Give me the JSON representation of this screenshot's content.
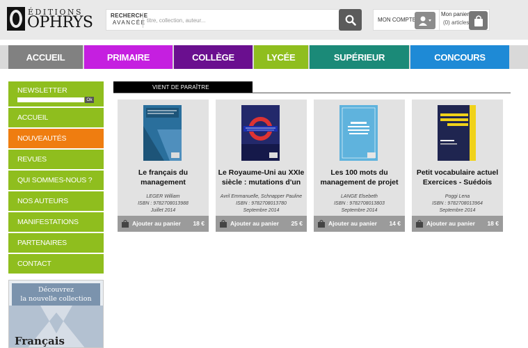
{
  "header": {
    "logo": {
      "top": "ÉDITIONS",
      "big": "OPHRYS"
    },
    "search": {
      "label_line1": "RECHERCHE",
      "label_line2": "AVANCÉE",
      "placeholder": "titre, collection, auteur..."
    },
    "account_label": "MON COMPTE",
    "cart": {
      "title": "Mon panier",
      "count": "(0) articles"
    }
  },
  "nav": {
    "tabs": [
      {
        "label": "ACCUEIL",
        "color": "#818181"
      },
      {
        "label": "PRIMAIRE",
        "color": "#c51fe0"
      },
      {
        "label": "COLLÈGE",
        "color": "#6a0f8f"
      },
      {
        "label": "LYCÉE",
        "color": "#8fbe1e"
      },
      {
        "label": "SUPÉRIEUR",
        "color": "#1b8a78"
      },
      {
        "label": "CONCOURS",
        "color": "#1e8ad6"
      }
    ]
  },
  "sidebar": {
    "newsletter": {
      "label": "NEWSLETTER",
      "ok": "Ok"
    },
    "items": [
      "ACCUEIL",
      "NOUVEAUTÉS",
      "REVUES",
      "QUI SOMMES-NOUS ?",
      "NOS AUTEURS",
      "MANIFESTATIONS",
      "PARTENAIRES",
      "CONTACT"
    ],
    "active_index": 1,
    "promo": {
      "line1": "Découvrez",
      "line2": "la nouvelle collection",
      "title": "Français"
    }
  },
  "main": {
    "section_title": "VIENT DE PARAÎTRE",
    "books": [
      {
        "title": "Le français du management",
        "author": "LEGER William",
        "isbn": "ISBN : 9782708013988",
        "date": "Juillet 2014",
        "cart_label": "Ajouter au panier",
        "price": "18 €"
      },
      {
        "title": "Le Royaume-Uni au XXIe siècle : mutations d'un",
        "author": "Avril Emmanuelle, Schnapper Pauline",
        "isbn": "ISBN : 9782708013780",
        "date": "Septembre 2014",
        "cart_label": "Ajouter au panier",
        "price": "25 €"
      },
      {
        "title": "Les 100 mots du management de projet",
        "author": "LANGE Elsebeth",
        "isbn": "ISBN : 9782708013803",
        "date": "Septembre 2014",
        "cart_label": "Ajouter au panier",
        "price": "14 €"
      },
      {
        "title": "Petit vocabulaire actuel Exercices - Suédois",
        "author": "Poggi Lena",
        "isbn": "ISBN : 9782708013964",
        "date": "Septembre 2014",
        "cart_label": "Ajouter au panier",
        "price": "18 €"
      }
    ]
  },
  "colors": {
    "sidebar_green": "#8fbe1e",
    "active_orange": "#ef7d10",
    "cart_gray": "#9b9b9b"
  }
}
